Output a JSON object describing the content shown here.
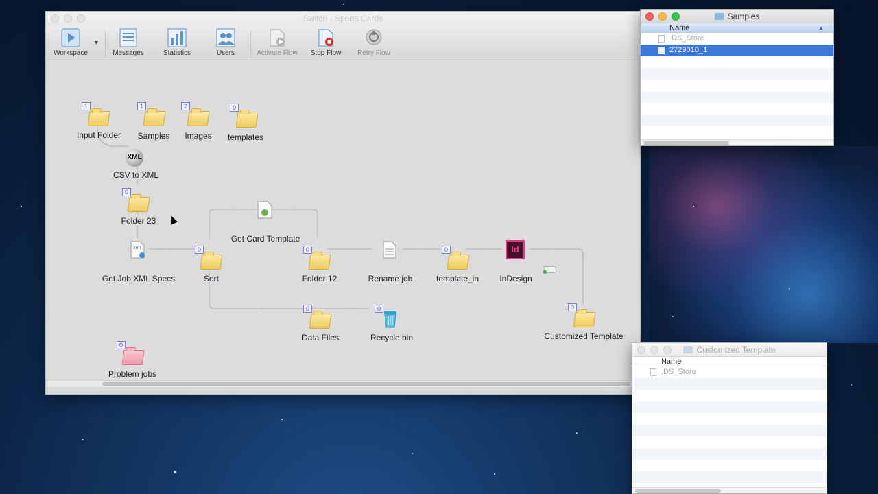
{
  "switch_window": {
    "title": "Switch - Sports Cards",
    "toolbar": {
      "workspace": "Workspace",
      "messages": "Messages",
      "statistics": "Statistics",
      "users": "Users",
      "activate_flow": "Activate Flow",
      "stop_flow": "Stop Flow",
      "retry_flow": "Retry Flow"
    },
    "flow": {
      "input_folder": {
        "label": "Input Folder",
        "count": "1"
      },
      "samples": {
        "label": "Samples",
        "count": "1"
      },
      "images": {
        "label": "Images",
        "count": "2"
      },
      "templates": {
        "label": "templates",
        "count": "0"
      },
      "csv_to_xml": {
        "label": "CSV to XML",
        "icon_text": "XML"
      },
      "folder_23": {
        "label": "Folder 23",
        "count": "0"
      },
      "get_card_template": {
        "label": "Get Card Template"
      },
      "get_job_xml_specs": {
        "label": "Get Job XML Specs",
        "icon_text": "xml"
      },
      "sort": {
        "label": "Sort",
        "count": "0"
      },
      "folder_12": {
        "label": "Folder 12",
        "count": "0"
      },
      "rename_job": {
        "label": "Rename job"
      },
      "template_in": {
        "label": "template_in",
        "count": "0"
      },
      "indesign": {
        "label": "InDesign",
        "icon_text": "Id"
      },
      "customized_template": {
        "label": "Customized Template",
        "count": "0"
      },
      "data_files": {
        "label": "Data Files",
        "count": "0"
      },
      "recycle_bin": {
        "label": "Recycle bin",
        "count": "0"
      },
      "problem_jobs": {
        "label": "Problem jobs",
        "count": "0"
      }
    }
  },
  "samples_window": {
    "title": "Samples",
    "column": "Name",
    "rows": [
      {
        "name": ".DS_Store"
      },
      {
        "name": "2729010_1"
      }
    ]
  },
  "customized_window": {
    "title": "Customized Template",
    "column": "Name",
    "rows": [
      {
        "name": ".DS_Store"
      }
    ]
  },
  "colors": {
    "selection": "#3b78d8",
    "indesign": "#e03e83",
    "badge_border": "#7b7fc8"
  }
}
